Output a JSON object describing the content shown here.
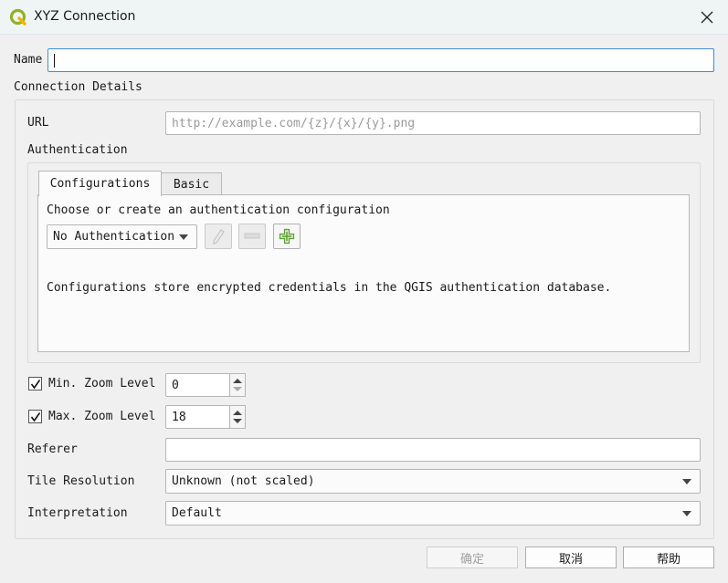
{
  "window": {
    "title": "XYZ Connection",
    "app_icon": "qgis-logo-icon",
    "close_icon": "close-icon"
  },
  "name_row": {
    "label": "Name",
    "value": ""
  },
  "connection_details": {
    "title": "Connection Details",
    "url": {
      "label": "URL",
      "value": "",
      "placeholder": "http://example.com/{z}/{x}/{y}.png"
    },
    "authentication": {
      "label": "Authentication",
      "tabs": [
        {
          "label": "Configurations",
          "active": true
        },
        {
          "label": "Basic",
          "active": false
        }
      ],
      "prompt": "Choose or create an authentication configuration",
      "config_select": {
        "value": "No Authentication"
      },
      "buttons": [
        {
          "icon": "edit-pencil-icon",
          "enabled": false
        },
        {
          "icon": "remove-minus-icon",
          "enabled": false
        },
        {
          "icon": "add-plus-icon",
          "enabled": true
        }
      ],
      "info": "Configurations store encrypted credentials in the QGIS authentication database."
    },
    "min_zoom": {
      "label": "Min. Zoom Level",
      "checked": true,
      "value": "0"
    },
    "max_zoom": {
      "label": "Max. Zoom Level",
      "checked": true,
      "value": "18"
    },
    "referer": {
      "label": "Referer",
      "value": ""
    },
    "tile_resolution": {
      "label": "Tile Resolution",
      "value": "Unknown (not scaled)"
    },
    "interpretation": {
      "label": "Interpretation",
      "value": "Default"
    }
  },
  "footer": {
    "ok_label": "确定",
    "cancel_label": "取消",
    "help_label": "帮助"
  },
  "colors": {
    "title_bar": "#eef5f4",
    "focus_border": "#3b8fd9",
    "qgis_green": "#93b023",
    "add_icon_green": "#5a9e3a"
  }
}
